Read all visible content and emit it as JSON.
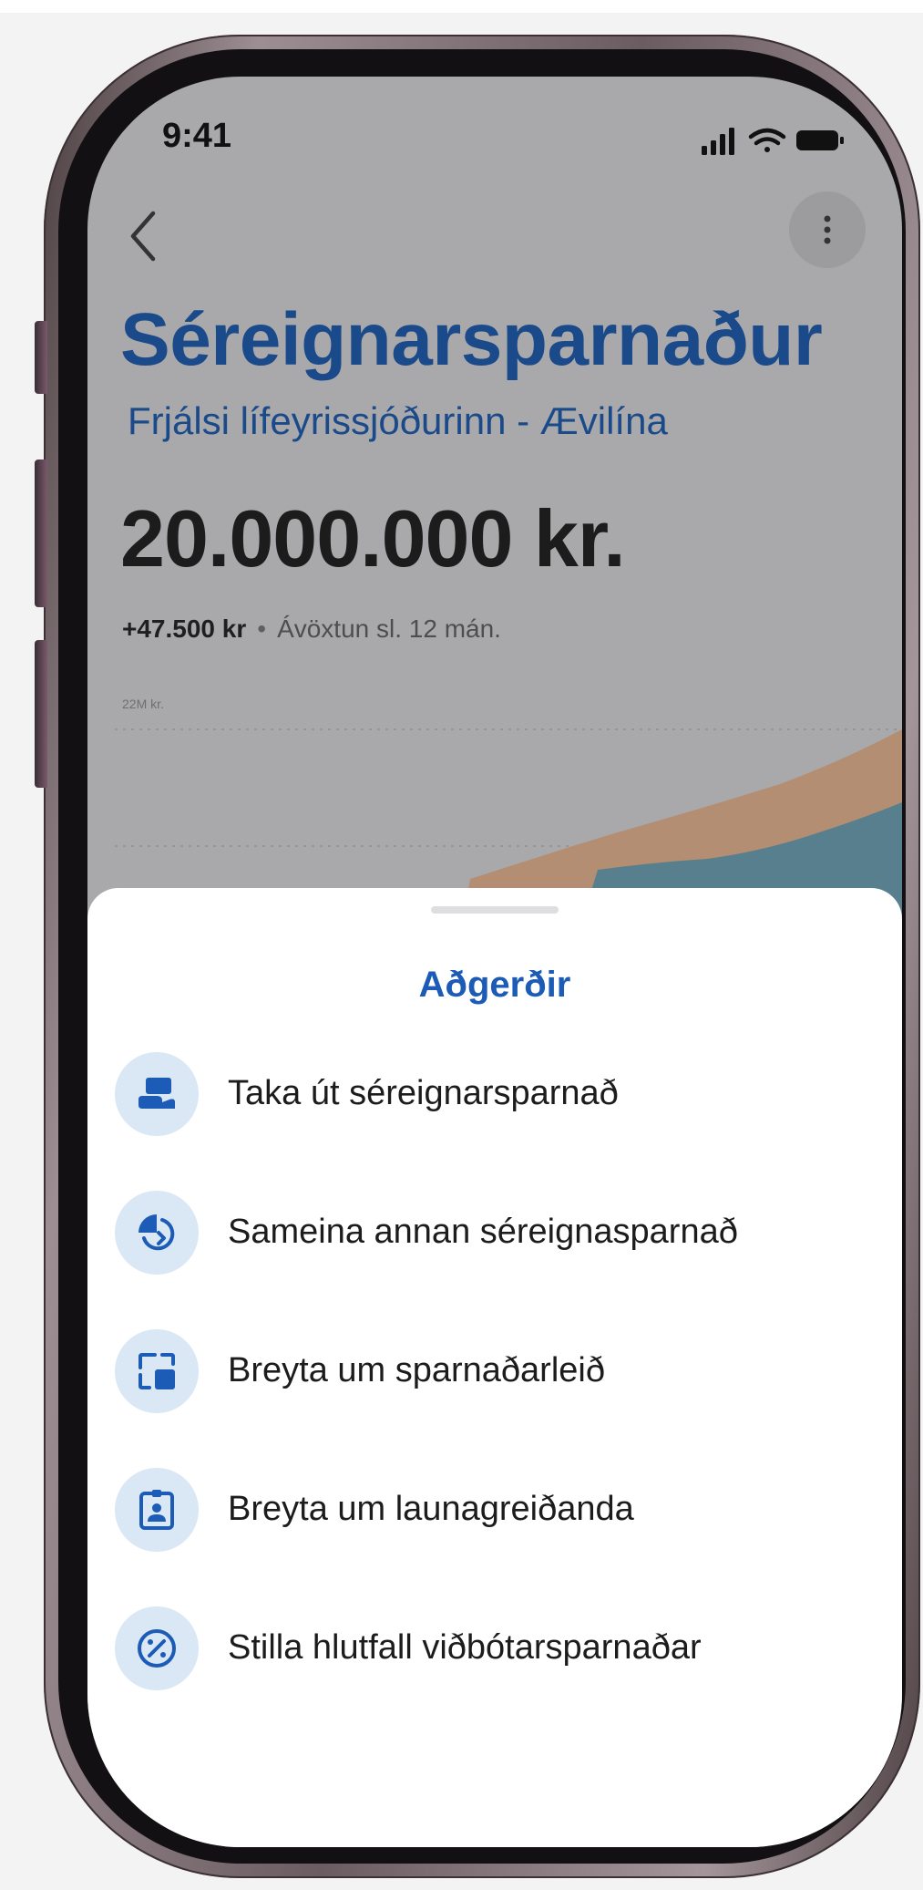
{
  "status_bar": {
    "time": "9:41"
  },
  "header": {
    "title": "Séreignarsparnaður",
    "subtitle": "Frjálsi lífeyrissjóðurinn - Ævilína"
  },
  "summary": {
    "balance": "20.000.000 kr.",
    "change_amount": "+47.500 kr",
    "separator": "•",
    "change_label": "Ávöxtun sl. 12 mán."
  },
  "chart": {
    "axis_label": "22M kr."
  },
  "sheet": {
    "title": "Aðgerðir",
    "actions": [
      {
        "label": "Taka út séreignarsparnað",
        "icon": "withdraw-icon"
      },
      {
        "label": "Sameina annan séreignasparnað",
        "icon": "merge-icon"
      },
      {
        "label": "Breyta um sparnaðarleið",
        "icon": "switch-plan-icon"
      },
      {
        "label": "Breyta um launagreiðanda",
        "icon": "employer-badge-icon"
      },
      {
        "label": "Stilla hlutfall viðbótarsparnaðar",
        "icon": "percentage-icon"
      }
    ]
  },
  "colors": {
    "brand_blue": "#1a4a8a",
    "accent_blue": "#1c5bb6",
    "icon_bg": "#dae7f5",
    "chart_tan": "#b38e72",
    "chart_teal": "#587f8e"
  }
}
